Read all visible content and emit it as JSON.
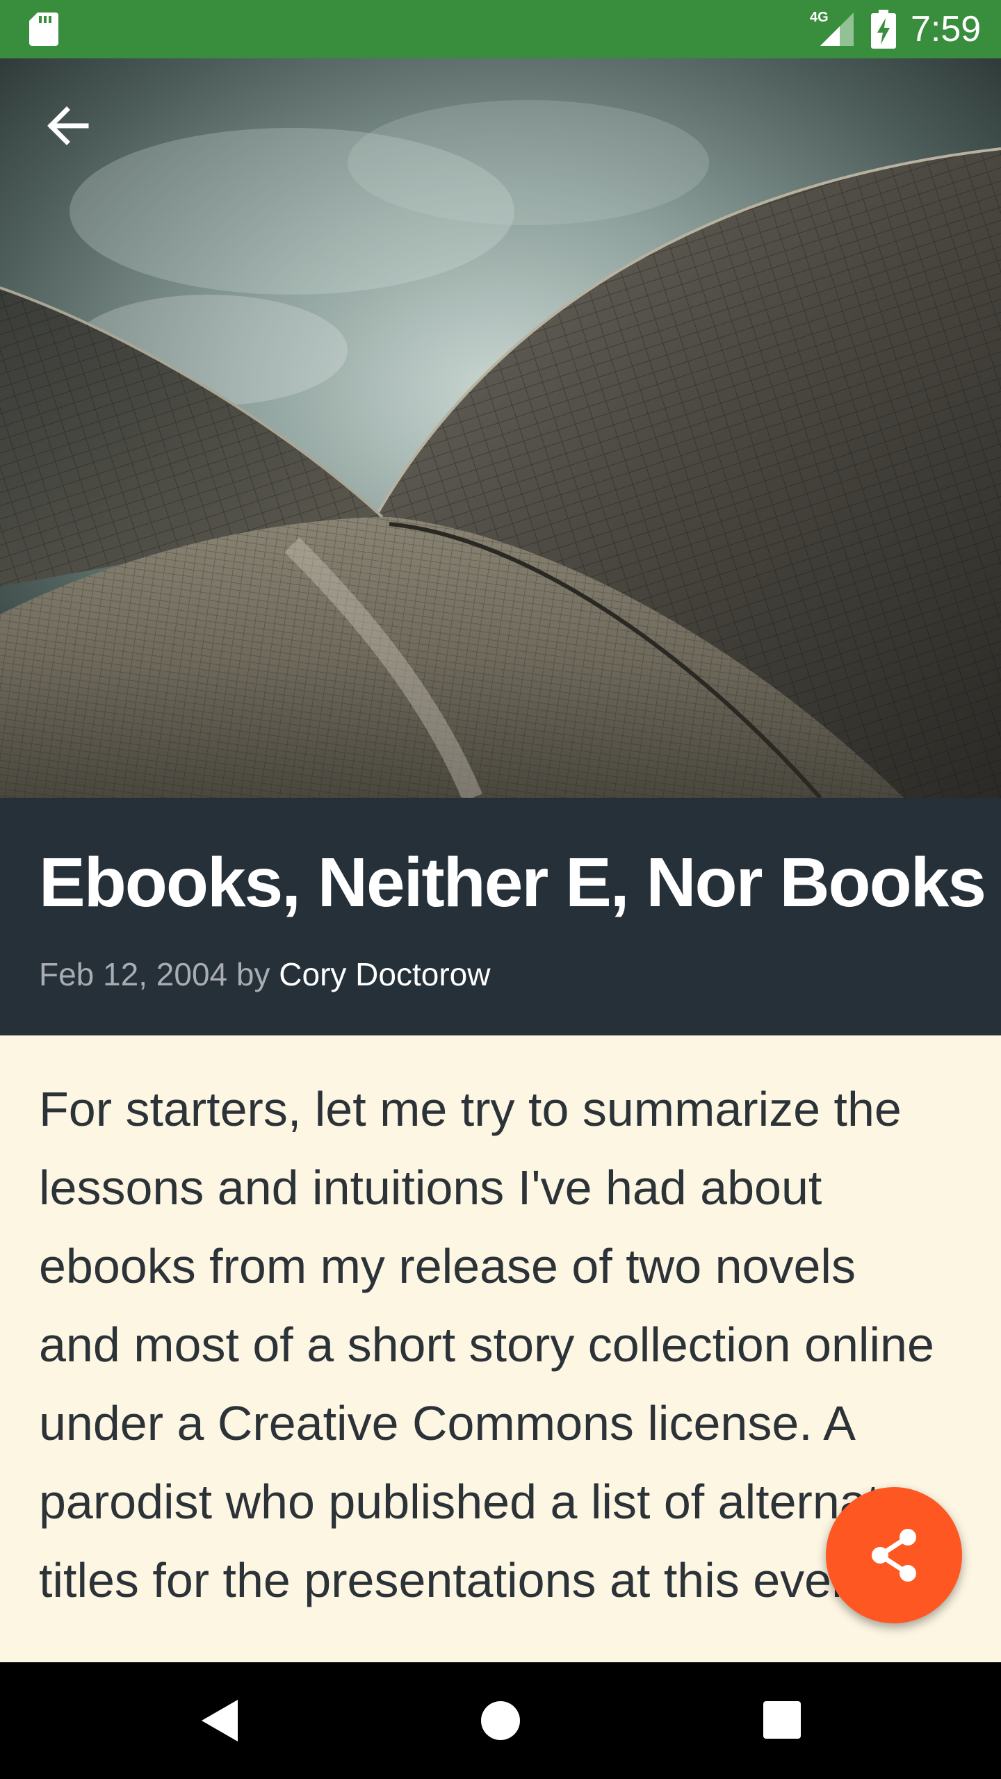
{
  "status_bar": {
    "network_label": "4G",
    "time": "7:59",
    "color": "#388e3c",
    "icons": [
      "sd-card-icon",
      "signal-icon",
      "battery-charging-icon"
    ]
  },
  "toolbar": {
    "back_icon": "arrow-back-icon"
  },
  "article": {
    "title": "Ebooks, Neither E, Nor Books",
    "date": "Feb 12, 2004",
    "by_label": "by",
    "author": "Cory Doctorow",
    "body": "For starters, let me try to summarize the lessons and intuitions I've had about ebooks from my release of two novels and most of a short story collection online under a Creative Commons license. A parodist who published a list of alternate titles for the presentations at this event"
  },
  "fab": {
    "icon": "share-icon",
    "color": "#ff5722"
  },
  "navigation_bar": {
    "icons": [
      "nav-back-icon",
      "nav-home-icon",
      "nav-recents-icon"
    ]
  },
  "colors": {
    "title_panel": "#263038",
    "page_background": "#fdf6e3",
    "body_text": "#2c3338"
  }
}
